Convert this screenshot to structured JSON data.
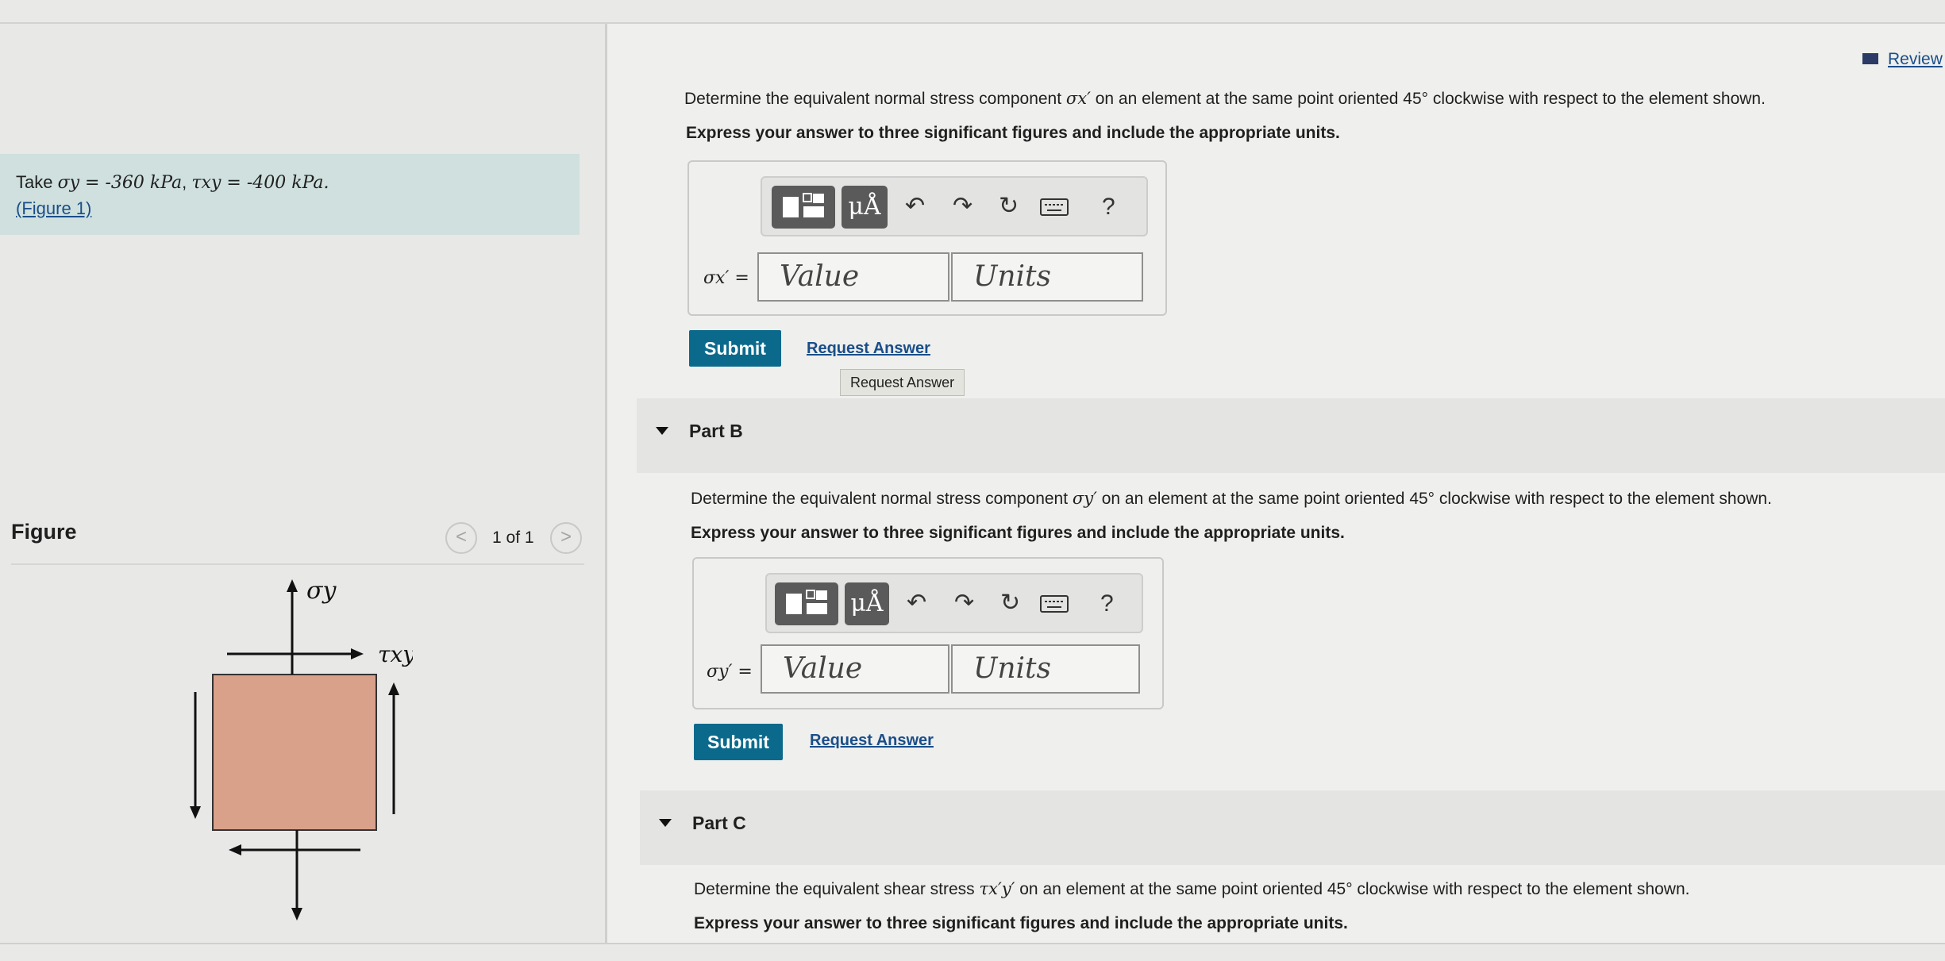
{
  "given": {
    "take_prefix": "Take",
    "sigma_y": "σy = -360 kPa",
    "tau_xy": "τxy = -400 kPa.",
    "figure_link": "(Figure 1)"
  },
  "figure": {
    "header": "Figure",
    "prev": "<",
    "count": "1 of 1",
    "next": ">",
    "label_sigma_y": "σy",
    "label_tau_xy": "τxy",
    "fill_color": "#d9a08a"
  },
  "review": {
    "label": "Review"
  },
  "partA": {
    "prompt_pre": "Determine the equivalent normal stress component",
    "prompt_sym": "σx′",
    "prompt_post": "on an element at the same point oriented 45° clockwise with respect to the element shown.",
    "instruction": "Express your answer to three significant figures and include the appropriate units.",
    "var_label": "σx′ =",
    "value_placeholder": "Value",
    "units_placeholder": "Units",
    "submit": "Submit",
    "request": "Request Answer",
    "tooltip": "Request Answer"
  },
  "partB": {
    "title": "Part B",
    "prompt_pre": "Determine the equivalent normal stress component",
    "prompt_sym": "σy′",
    "prompt_post": "on an element at the same point oriented 45° clockwise with respect to the element shown.",
    "instruction": "Express your answer to three significant figures and include the appropriate units.",
    "var_label": "σy′ =",
    "value_placeholder": "Value",
    "units_placeholder": "Units",
    "submit": "Submit",
    "request": "Request Answer"
  },
  "partC": {
    "title": "Part C",
    "prompt_pre": "Determine the equivalent shear stress",
    "prompt_sym": "τx′y′",
    "prompt_post": "on an element at the same point oriented 45° clockwise with respect to the element shown.",
    "instruction": "Express your answer to three significant figures and include the appropriate units."
  },
  "toolbar": {
    "units_icon": "μÅ",
    "undo_icon": "↶",
    "redo_icon": "↷",
    "reset_icon": "↻",
    "help_icon": "?"
  },
  "colors": {
    "accent": "#0b6a8c",
    "given_bg": "#cfe0de"
  }
}
